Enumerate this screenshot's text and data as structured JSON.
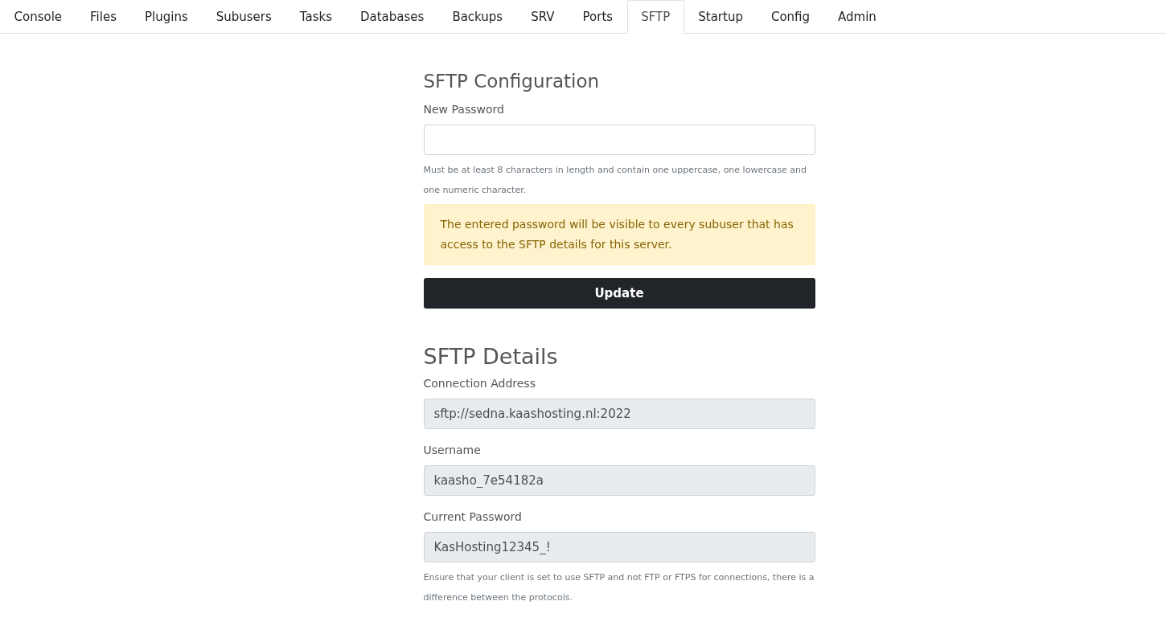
{
  "tabs": [
    {
      "label": "Console",
      "selected": false
    },
    {
      "label": "Files",
      "selected": false
    },
    {
      "label": "Plugins",
      "selected": false
    },
    {
      "label": "Subusers",
      "selected": false
    },
    {
      "label": "Tasks",
      "selected": false
    },
    {
      "label": "Databases",
      "selected": false
    },
    {
      "label": "Backups",
      "selected": false
    },
    {
      "label": "SRV",
      "selected": false
    },
    {
      "label": "Ports",
      "selected": false
    },
    {
      "label": "SFTP",
      "selected": true
    },
    {
      "label": "Startup",
      "selected": false
    },
    {
      "label": "Config",
      "selected": false
    },
    {
      "label": "Admin",
      "selected": false
    }
  ],
  "configuration": {
    "title": "SFTP Configuration",
    "password_label": "New Password",
    "help": "Must be at least 8 characters in length and contain one uppercase, one lowercase and one numeric character.",
    "warning": "The entered password will be visible to every subuser that has access to the SFTP details for this server.",
    "button": "Update"
  },
  "details": {
    "title": "SFTP Details",
    "fields": [
      {
        "label": "Connection Address",
        "value": "sftp://sedna.kaashosting.nl:2022"
      },
      {
        "label": "Username",
        "value": "kaasho_7e54182a"
      },
      {
        "label": "Current Password",
        "value": "KasHosting12345_!"
      }
    ],
    "help": "Ensure that your client is set to use SFTP and not FTP or FTPS for connections, there is a difference between the protocols."
  }
}
